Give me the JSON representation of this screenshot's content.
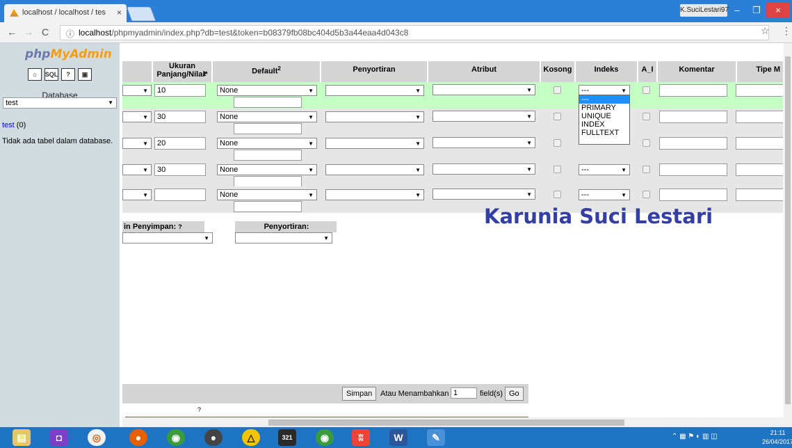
{
  "browser": {
    "tab_title": "localhost / localhost / tes",
    "tab_close": "×",
    "user": "K.SuciLestari97",
    "url_host": "localhost",
    "url_path": "/phpmyadmin/index.php?db=test&token=b08379fb08bc404d5b3a44eaa4d043c8",
    "star": "☆",
    "menu": "⋮",
    "back": "←",
    "forward": "→",
    "reload": "C",
    "info": "ⓘ",
    "minimize": "–",
    "maximize": "❐",
    "close": "×"
  },
  "sidebar": {
    "logo_php": "php",
    "logo_my": "MyAdmin",
    "db_label": "Database",
    "db_selected": "test",
    "db_link": "test",
    "db_count": " (0)",
    "no_tables": "Tidak ada tabel dalam database.",
    "icon_labels": [
      "⌂",
      "SQL",
      "?",
      "▣"
    ]
  },
  "table": {
    "headers": [
      "Ukuran Panjang/Nilai*",
      "Default",
      "Penyortiran",
      "Atribut",
      "Kosong",
      "Indeks",
      "A_I",
      "Komentar",
      "Tipe M"
    ],
    "header_sup": [
      "1",
      "2"
    ],
    "rows": [
      {
        "length": "10",
        "default": "None",
        "index": "---"
      },
      {
        "length": "30",
        "default": "None",
        "index": ""
      },
      {
        "length": "20",
        "default": "None",
        "index": ""
      },
      {
        "length": "30",
        "default": "None",
        "index": "---"
      },
      {
        "length": "",
        "default": "None",
        "index": "---"
      }
    ],
    "index_options": [
      "---",
      "PRIMARY",
      "UNIQUE",
      "INDEX",
      "FULLTEXT"
    ]
  },
  "watermark": "Karunia Suci Lestari",
  "storage": {
    "engine_label": "in Penyimpan:",
    "help": "?",
    "collation_label": "Penyortiran:"
  },
  "savebar": {
    "save": "Simpan",
    "add_label": "Atau Menambahkan",
    "fields_value": "1",
    "fields_label": "field(s)",
    "go": "Go",
    "help": "?"
  },
  "taskbar": {
    "time": "21:11",
    "date": "26/04/2017"
  },
  "colors": {
    "highlight_row": "#c6ffc6",
    "row_gray": "#e6e6e6",
    "watermark": "#333fa5",
    "taskbar": "#1e73c2"
  }
}
